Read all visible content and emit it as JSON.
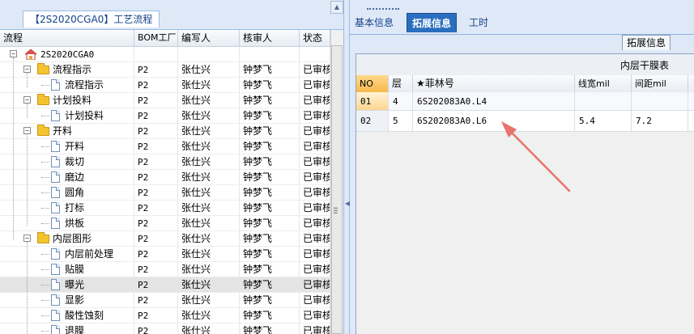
{
  "left_panel": {
    "title": "【2S2020CGA0】工艺流程",
    "columns": [
      "流程",
      "BOM工厂",
      "编写人",
      "核审人",
      "状态"
    ],
    "rows": [
      {
        "level": 0,
        "type": "root",
        "label": "2S2020CGA0",
        "bom": "",
        "writer": "",
        "reviewer": "",
        "status": ""
      },
      {
        "level": 1,
        "type": "folder",
        "label": "流程指示",
        "bom": "P2",
        "writer": "张仕兴",
        "reviewer": "钟梦飞",
        "status": "已审核"
      },
      {
        "level": 2,
        "type": "doc",
        "label": "流程指示",
        "bom": "P2",
        "writer": "张仕兴",
        "reviewer": "钟梦飞",
        "status": "已审核"
      },
      {
        "level": 1,
        "type": "folder",
        "label": "计划投料",
        "bom": "P2",
        "writer": "张仕兴",
        "reviewer": "钟梦飞",
        "status": "已审核"
      },
      {
        "level": 2,
        "type": "doc",
        "label": "计划投料",
        "bom": "P2",
        "writer": "张仕兴",
        "reviewer": "钟梦飞",
        "status": "已审核"
      },
      {
        "level": 1,
        "type": "folder",
        "label": "开料",
        "bom": "P2",
        "writer": "张仕兴",
        "reviewer": "钟梦飞",
        "status": "已审核"
      },
      {
        "level": 2,
        "type": "doc",
        "label": "开料",
        "bom": "P2",
        "writer": "张仕兴",
        "reviewer": "钟梦飞",
        "status": "已审核"
      },
      {
        "level": 2,
        "type": "doc",
        "label": "裁切",
        "bom": "P2",
        "writer": "张仕兴",
        "reviewer": "钟梦飞",
        "status": "已审核"
      },
      {
        "level": 2,
        "type": "doc",
        "label": "磨边",
        "bom": "P2",
        "writer": "张仕兴",
        "reviewer": "钟梦飞",
        "status": "已审核"
      },
      {
        "level": 2,
        "type": "doc",
        "label": "圆角",
        "bom": "P2",
        "writer": "张仕兴",
        "reviewer": "钟梦飞",
        "status": "已审核"
      },
      {
        "level": 2,
        "type": "doc",
        "label": "打标",
        "bom": "P2",
        "writer": "张仕兴",
        "reviewer": "钟梦飞",
        "status": "已审核"
      },
      {
        "level": 2,
        "type": "doc",
        "label": "烘板",
        "bom": "P2",
        "writer": "张仕兴",
        "reviewer": "钟梦飞",
        "status": "已审核"
      },
      {
        "level": 1,
        "type": "folder",
        "label": "内层图形",
        "bom": "P2",
        "writer": "张仕兴",
        "reviewer": "钟梦飞",
        "status": "已审核"
      },
      {
        "level": 2,
        "type": "doc",
        "label": "内层前处理",
        "bom": "P2",
        "writer": "张仕兴",
        "reviewer": "钟梦飞",
        "status": "已审核"
      },
      {
        "level": 2,
        "type": "doc",
        "label": "贴膜",
        "bom": "P2",
        "writer": "张仕兴",
        "reviewer": "钟梦飞",
        "status": "已审核"
      },
      {
        "level": 2,
        "type": "doc",
        "label": "曝光",
        "bom": "P2",
        "writer": "张仕兴",
        "reviewer": "钟梦飞",
        "status": "已审核",
        "selected": true
      },
      {
        "level": 2,
        "type": "doc",
        "label": "显影",
        "bom": "P2",
        "writer": "张仕兴",
        "reviewer": "钟梦飞",
        "status": "已审核"
      },
      {
        "level": 2,
        "type": "doc",
        "label": "酸性蚀刻",
        "bom": "P2",
        "writer": "张仕兴",
        "reviewer": "钟梦飞",
        "status": "已审核"
      },
      {
        "level": 2,
        "type": "doc",
        "label": "退膜",
        "bom": "P2",
        "writer": "张仕兴",
        "reviewer": "钟梦飞",
        "status": "已审核"
      }
    ]
  },
  "right_panel": {
    "tabs": [
      "基本信息",
      "拓展信息",
      "工时"
    ],
    "active_tab": 1,
    "sub_tab": "拓展信息",
    "group_header": "内层干膜表",
    "columns": [
      "NO",
      "层",
      "★菲林号",
      "线宽mil",
      "间距mil"
    ],
    "rows": [
      {
        "no": "01",
        "layer": "4",
        "film": "6S202083A0.L4",
        "width": "",
        "spacing": ""
      },
      {
        "no": "02",
        "layer": "5",
        "film": "6S202083A0.L6",
        "width": "5.4",
        "spacing": "7.2"
      }
    ]
  },
  "colors": {
    "accent": "#2a6ebf",
    "annotation_arrow": "#e8736b",
    "folder": "#f4c430"
  }
}
